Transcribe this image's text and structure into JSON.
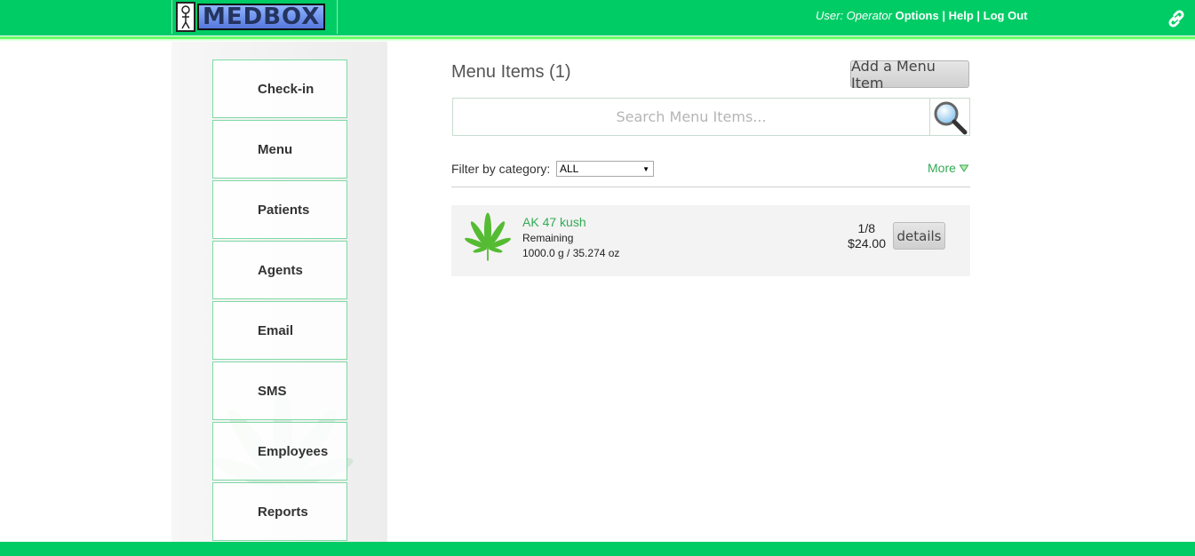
{
  "header": {
    "logo_text": "MEDBOX",
    "user_label": "User: Operator",
    "links": [
      "Options",
      "Help",
      "Log Out"
    ],
    "separator": "|",
    "link_icon": "chain-link-icon"
  },
  "sidebar": {
    "items": [
      {
        "label": "Check-in"
      },
      {
        "label": "Menu"
      },
      {
        "label": "Patients"
      },
      {
        "label": "Agents"
      },
      {
        "label": "Email"
      },
      {
        "label": "SMS"
      },
      {
        "label": "Employees"
      },
      {
        "label": "Reports"
      }
    ]
  },
  "main": {
    "title": "Menu Items (1)",
    "add_button": "Add a Menu Item",
    "search": {
      "placeholder": "Search Menu Items...",
      "value": ""
    },
    "filter": {
      "label": "Filter by category:",
      "selected": "ALL"
    },
    "more_label": "More",
    "items": [
      {
        "name": "AK 47 kush",
        "remaining_label": "Remaining",
        "remaining_value": "1000.0 g / 35.274 oz",
        "quantity": "1/8",
        "price": "$24.00",
        "details_label": "details"
      }
    ]
  },
  "colors": {
    "brand_green": "#00cc66",
    "link_green": "#33aa55"
  }
}
